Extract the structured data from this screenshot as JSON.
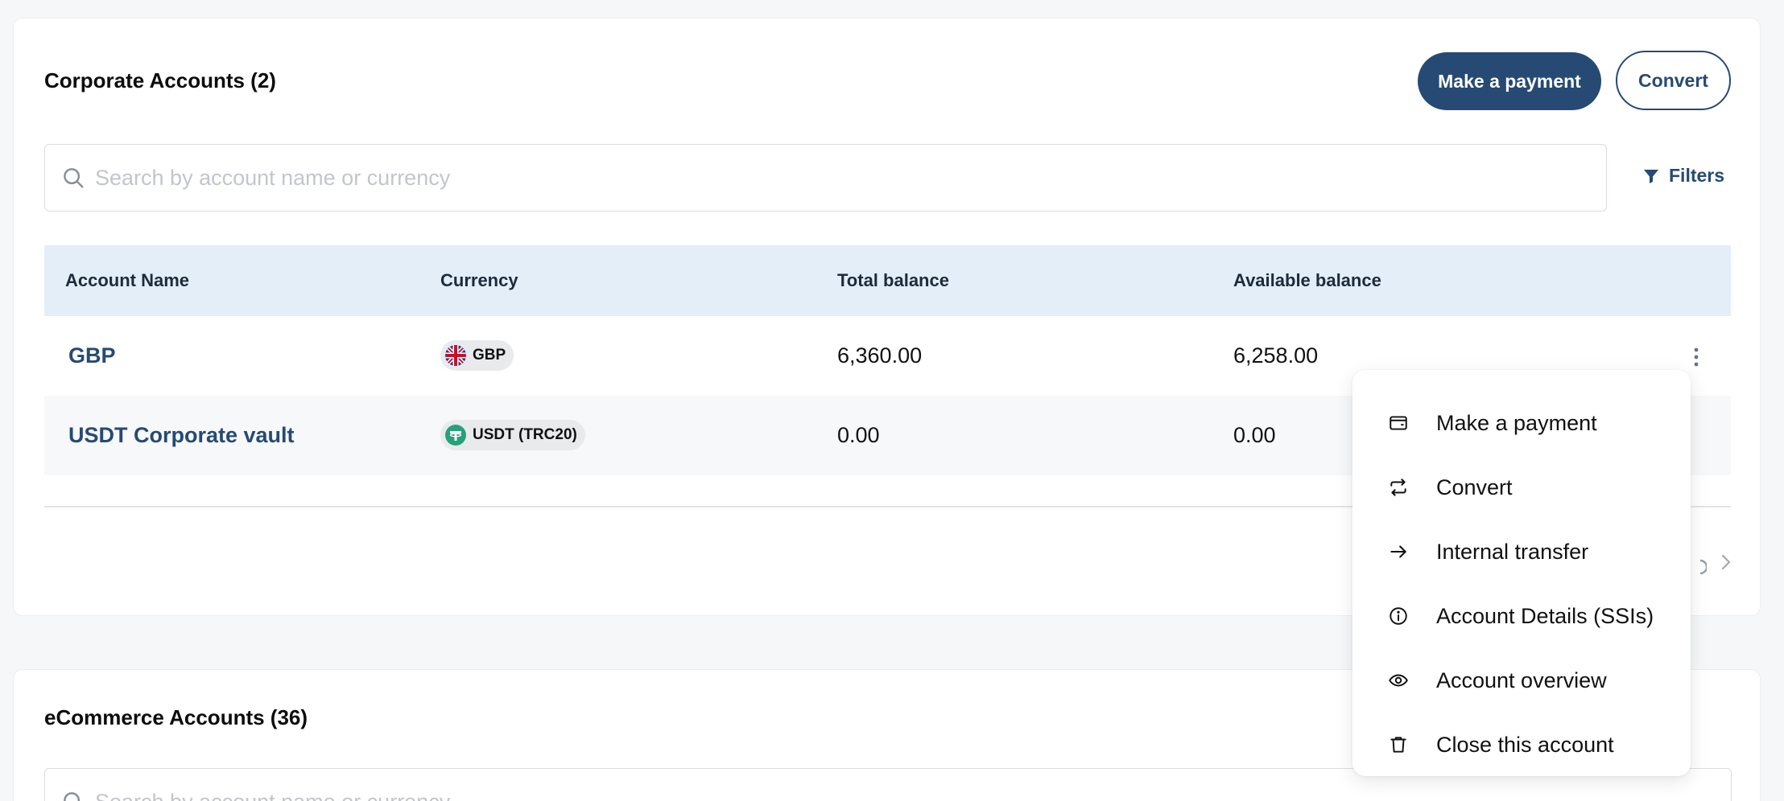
{
  "corporate": {
    "title": "Corporate Accounts (2)",
    "make_payment_label": "Make a payment",
    "convert_label": "Convert",
    "search_placeholder": "Search by account name or currency",
    "filters_label": "Filters",
    "columns": [
      "Account Name",
      "Currency",
      "Total balance",
      "Available balance"
    ],
    "rows": [
      {
        "name": "GBP",
        "currency": "GBP",
        "currency_icon": "uk-flag-icon",
        "total": "6,360.00",
        "available": "6,258.00"
      },
      {
        "name": "USDT Corporate vault",
        "currency": "USDT (TRC20)",
        "currency_icon": "tether-icon",
        "total": "0.00",
        "available": "0.00"
      }
    ]
  },
  "ecommerce": {
    "title": "eCommerce Accounts (36)",
    "search_placeholder": "Search by account name or currency"
  },
  "row_menu": {
    "items": [
      {
        "label": "Make a payment",
        "icon": "wallet-icon"
      },
      {
        "label": "Convert",
        "icon": "convert-arrows-icon"
      },
      {
        "label": "Internal transfer",
        "icon": "arrow-right-icon"
      },
      {
        "label": "Account Details (SSIs)",
        "icon": "info-icon"
      },
      {
        "label": "Account overview",
        "icon": "eye-icon"
      },
      {
        "label": "Close this account",
        "icon": "trash-icon"
      }
    ]
  },
  "colors": {
    "primary": "#264a73",
    "table_header_bg": "#e3eef8",
    "page_bg": "#f6f7f9"
  }
}
